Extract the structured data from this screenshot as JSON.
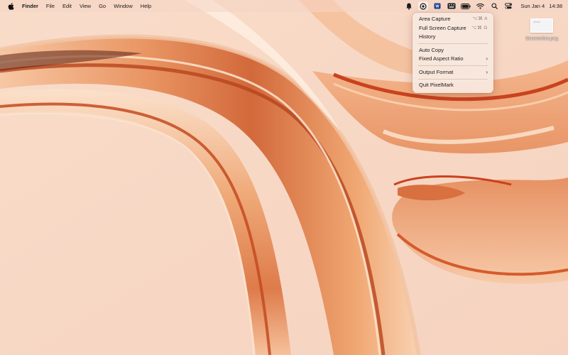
{
  "menubar": {
    "app_menu": "Finder",
    "menus": [
      "File",
      "Edit",
      "View",
      "Go",
      "Window",
      "Help"
    ],
    "status_icons": [
      "notification-icon",
      "pixelmark-icon",
      "text-icon",
      "keyboard-icon",
      "battery-icon",
      "wifi-icon",
      "spotlight-icon",
      "control-center-icon"
    ],
    "date": "Sun Jan 4",
    "time": "14:38"
  },
  "dropdown": {
    "items": [
      {
        "label": "Area Capture",
        "shortcut": "⌥⌘ A"
      },
      {
        "label": "Full Screen Capture",
        "shortcut": "⌥⌘ G"
      },
      {
        "label": "History"
      },
      {
        "label": "Auto Copy"
      },
      {
        "label": "Fixed Aspect Ratio",
        "submenu": "›"
      },
      {
        "label": "Output Format",
        "submenu": "›"
      },
      {
        "label": "Quit PixelMark"
      }
    ]
  },
  "desktop": {
    "file_label": "Screenshot.png"
  },
  "colors": {
    "wallpaper_base": "#f6d9c6",
    "ribbon_orange": "#e07a45",
    "ribbon_red": "#c8401c",
    "ribbon_light": "#f9cfa8"
  }
}
